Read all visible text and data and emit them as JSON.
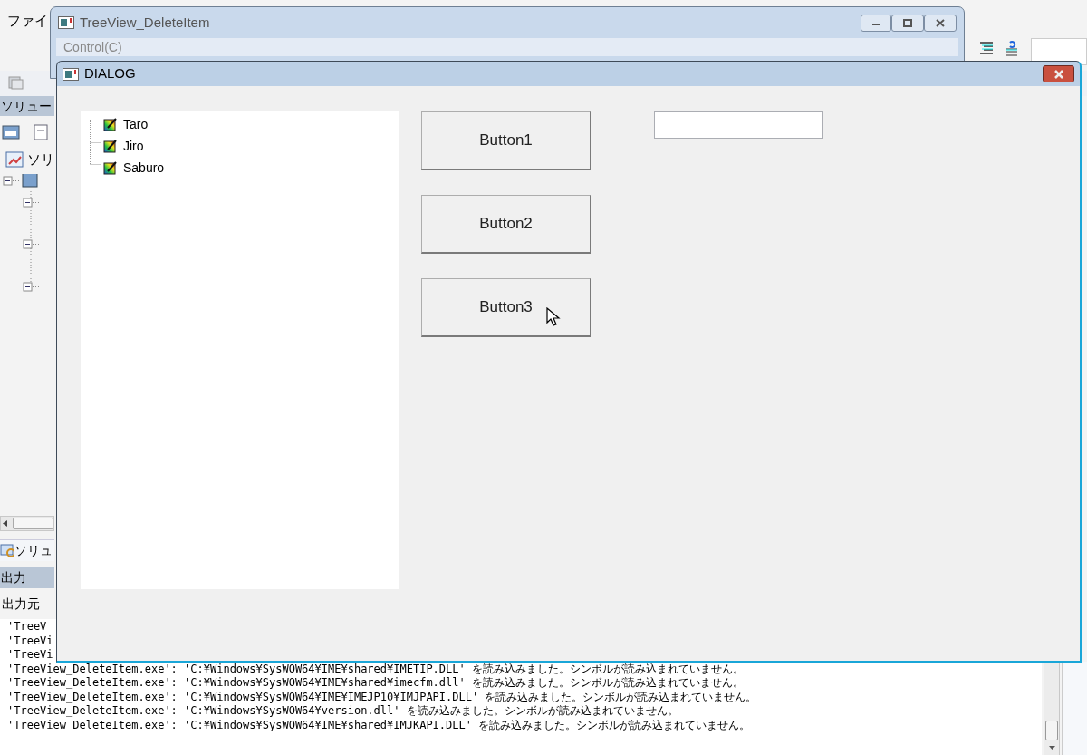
{
  "ide": {
    "menu_fragment": "ファイ",
    "solution_panel": {
      "title": "ソリュー",
      "root": "ソリ"
    },
    "tab_fragment": "ソリュ",
    "output_panel": {
      "title": "出力",
      "source_label": "出力元",
      "lines": [
        "'TreeV",
        "'TreeVi",
        "'TreeVi",
        "'TreeView_DeleteItem.exe': 'C:¥Windows¥SysWOW64¥IME¥shared¥IMETIP.DLL' を読み込みました。シンボルが読み込まれていません。",
        "'TreeView_DeleteItem.exe': 'C:¥Windows¥SysWOW64¥IME¥shared¥imecfm.dll' を読み込みました。シンボルが読み込まれていません。",
        "'TreeView_DeleteItem.exe': 'C:¥Windows¥SysWOW64¥IME¥IMEJP10¥IMJPAPI.DLL' を読み込みました。シンボルが読み込まれていません。",
        "'TreeView_DeleteItem.exe': 'C:¥Windows¥SysWOW64¥version.dll' を読み込みました。シンボルが読み込まれていません。",
        "'TreeView_DeleteItem.exe': 'C:¥Windows¥SysWOW64¥IME¥shared¥IMJKAPI.DLL' を読み込みました。シンボルが読み込まれていません。"
      ]
    }
  },
  "app_window": {
    "title": "TreeView_DeleteItem",
    "menu": [
      "Control(C)"
    ]
  },
  "dialog": {
    "title": "DIALOG",
    "tree": [
      {
        "label": "Taro"
      },
      {
        "label": "Jiro"
      },
      {
        "label": "Saburo"
      }
    ],
    "buttons": [
      "Button1",
      "Button2",
      "Button3"
    ]
  }
}
